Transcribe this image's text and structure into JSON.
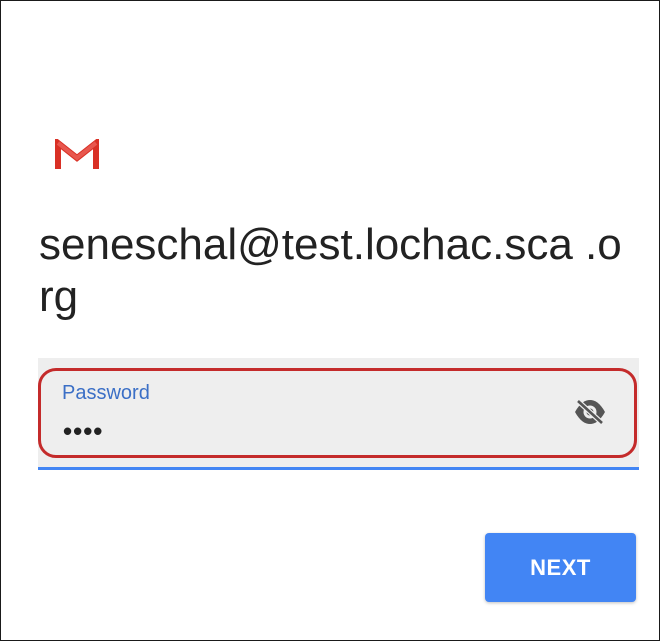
{
  "app": {
    "logo_icon": "gmail-logo-icon",
    "account_email": "seneschal@test.lochac.sca .org"
  },
  "password_field": {
    "label": "Password",
    "masked_value": "••••",
    "visibility_icon": "visibility-off-icon",
    "highlighted": true
  },
  "actions": {
    "next_label": "NEXT"
  },
  "colors": {
    "accent": "#4285f4",
    "label": "#3b6fc6",
    "highlight_outline": "#c42b2b",
    "logo_red": "#d93025",
    "field_background": "#eeeeee"
  }
}
